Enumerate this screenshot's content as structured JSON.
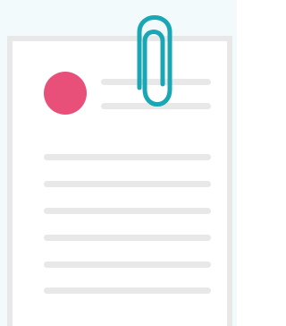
{
  "illustration": {
    "icon": "attached-document-icon",
    "colors": {
      "background": "#f2fafb",
      "paper": "#ffffff",
      "paper_border": "#e8e8e8",
      "avatar": "#e8507a",
      "text_lines": "#e8e8e8",
      "clip": "#1aa7b5"
    },
    "header_line_count": 2,
    "body_line_count": 6
  }
}
